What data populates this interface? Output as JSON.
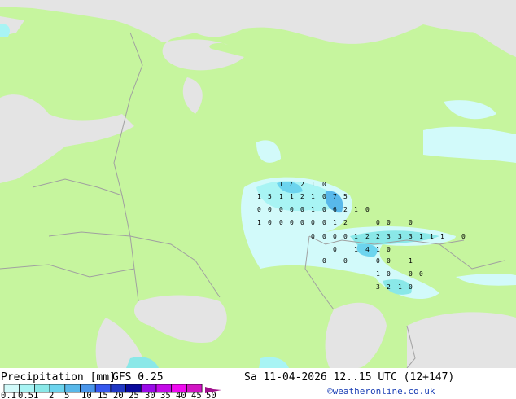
{
  "title": "Precipitation [mm]",
  "model": "GFS 0.25",
  "valid_time": "Sa 11-04-2026 12..15 UTC (12+147)",
  "credit": "©weatheronline.co.uk",
  "colors": {
    "land": "#c6f59e",
    "sea": "#e4e4e4",
    "border": "#a0a0a0",
    "credit": "#1b3fb5"
  },
  "legend": {
    "labels": [
      "0.1",
      "0.5",
      "1",
      "2",
      "5",
      "10",
      "15",
      "20",
      "25",
      "30",
      "35",
      "40",
      "45",
      "50"
    ],
    "colors": [
      "#d2fafa",
      "#a8f4f4",
      "#8ae8e8",
      "#6cd4ee",
      "#58b8ea",
      "#4a96ea",
      "#3658ee",
      "#2038c4",
      "#0a0a9c",
      "#9a0ae8",
      "#c40ae8",
      "#f00af0",
      "#d214c4"
    ]
  },
  "station_values": [
    "1",
    "7",
    "2",
    "1",
    "0",
    "1",
    "5",
    "1",
    "1",
    "2",
    "1",
    "0",
    "7",
    "5",
    "0",
    "0",
    "0",
    "0",
    "0",
    "1",
    "0",
    "6",
    "2",
    "1",
    "0",
    "1",
    "0",
    "0",
    "0",
    "0",
    "0",
    "0",
    "1",
    "2",
    "0",
    "0",
    "0",
    "0",
    "0",
    "0",
    "0",
    "1",
    "2",
    "2",
    "3",
    "3",
    "3",
    "1",
    "1",
    "1",
    "0",
    "0",
    "1",
    "4",
    "1",
    "0",
    "0",
    "0",
    "0",
    "0",
    "1",
    "1",
    "0",
    "0",
    "0",
    "3",
    "2",
    "1",
    "0"
  ]
}
